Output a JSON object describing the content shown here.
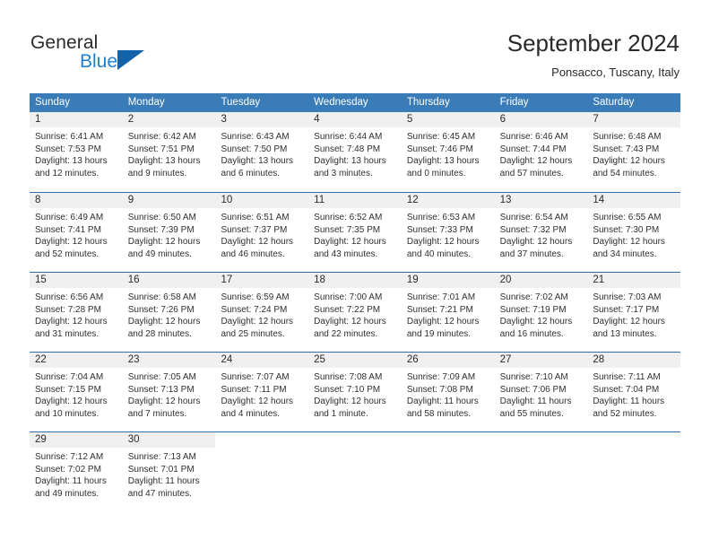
{
  "brand": {
    "name_part1": "General",
    "name_part2": "Blue",
    "triangle_color": "#1162a8",
    "blue_text_color": "#1f7fd0"
  },
  "header": {
    "month_title": "September 2024",
    "location": "Ponsacco, Tuscany, Italy"
  },
  "theme": {
    "header_row_bg": "#3a7cb8",
    "row_separator": "#2f6fae",
    "day_head_bg": "#f0f0f0",
    "page_bg": "#ffffff",
    "text": "#2a2a2a"
  },
  "weekdays": [
    "Sunday",
    "Monday",
    "Tuesday",
    "Wednesday",
    "Thursday",
    "Friday",
    "Saturday"
  ],
  "weeks": [
    [
      {
        "day": "1",
        "sunrise": "Sunrise: 6:41 AM",
        "sunset": "Sunset: 7:53 PM",
        "daylight_line1": "Daylight: 13 hours",
        "daylight_line2": "and 12 minutes."
      },
      {
        "day": "2",
        "sunrise": "Sunrise: 6:42 AM",
        "sunset": "Sunset: 7:51 PM",
        "daylight_line1": "Daylight: 13 hours",
        "daylight_line2": "and 9 minutes."
      },
      {
        "day": "3",
        "sunrise": "Sunrise: 6:43 AM",
        "sunset": "Sunset: 7:50 PM",
        "daylight_line1": "Daylight: 13 hours",
        "daylight_line2": "and 6 minutes."
      },
      {
        "day": "4",
        "sunrise": "Sunrise: 6:44 AM",
        "sunset": "Sunset: 7:48 PM",
        "daylight_line1": "Daylight: 13 hours",
        "daylight_line2": "and 3 minutes."
      },
      {
        "day": "5",
        "sunrise": "Sunrise: 6:45 AM",
        "sunset": "Sunset: 7:46 PM",
        "daylight_line1": "Daylight: 13 hours",
        "daylight_line2": "and 0 minutes."
      },
      {
        "day": "6",
        "sunrise": "Sunrise: 6:46 AM",
        "sunset": "Sunset: 7:44 PM",
        "daylight_line1": "Daylight: 12 hours",
        "daylight_line2": "and 57 minutes."
      },
      {
        "day": "7",
        "sunrise": "Sunrise: 6:48 AM",
        "sunset": "Sunset: 7:43 PM",
        "daylight_line1": "Daylight: 12 hours",
        "daylight_line2": "and 54 minutes."
      }
    ],
    [
      {
        "day": "8",
        "sunrise": "Sunrise: 6:49 AM",
        "sunset": "Sunset: 7:41 PM",
        "daylight_line1": "Daylight: 12 hours",
        "daylight_line2": "and 52 minutes."
      },
      {
        "day": "9",
        "sunrise": "Sunrise: 6:50 AM",
        "sunset": "Sunset: 7:39 PM",
        "daylight_line1": "Daylight: 12 hours",
        "daylight_line2": "and 49 minutes."
      },
      {
        "day": "10",
        "sunrise": "Sunrise: 6:51 AM",
        "sunset": "Sunset: 7:37 PM",
        "daylight_line1": "Daylight: 12 hours",
        "daylight_line2": "and 46 minutes."
      },
      {
        "day": "11",
        "sunrise": "Sunrise: 6:52 AM",
        "sunset": "Sunset: 7:35 PM",
        "daylight_line1": "Daylight: 12 hours",
        "daylight_line2": "and 43 minutes."
      },
      {
        "day": "12",
        "sunrise": "Sunrise: 6:53 AM",
        "sunset": "Sunset: 7:33 PM",
        "daylight_line1": "Daylight: 12 hours",
        "daylight_line2": "and 40 minutes."
      },
      {
        "day": "13",
        "sunrise": "Sunrise: 6:54 AM",
        "sunset": "Sunset: 7:32 PM",
        "daylight_line1": "Daylight: 12 hours",
        "daylight_line2": "and 37 minutes."
      },
      {
        "day": "14",
        "sunrise": "Sunrise: 6:55 AM",
        "sunset": "Sunset: 7:30 PM",
        "daylight_line1": "Daylight: 12 hours",
        "daylight_line2": "and 34 minutes."
      }
    ],
    [
      {
        "day": "15",
        "sunrise": "Sunrise: 6:56 AM",
        "sunset": "Sunset: 7:28 PM",
        "daylight_line1": "Daylight: 12 hours",
        "daylight_line2": "and 31 minutes."
      },
      {
        "day": "16",
        "sunrise": "Sunrise: 6:58 AM",
        "sunset": "Sunset: 7:26 PM",
        "daylight_line1": "Daylight: 12 hours",
        "daylight_line2": "and 28 minutes."
      },
      {
        "day": "17",
        "sunrise": "Sunrise: 6:59 AM",
        "sunset": "Sunset: 7:24 PM",
        "daylight_line1": "Daylight: 12 hours",
        "daylight_line2": "and 25 minutes."
      },
      {
        "day": "18",
        "sunrise": "Sunrise: 7:00 AM",
        "sunset": "Sunset: 7:22 PM",
        "daylight_line1": "Daylight: 12 hours",
        "daylight_line2": "and 22 minutes."
      },
      {
        "day": "19",
        "sunrise": "Sunrise: 7:01 AM",
        "sunset": "Sunset: 7:21 PM",
        "daylight_line1": "Daylight: 12 hours",
        "daylight_line2": "and 19 minutes."
      },
      {
        "day": "20",
        "sunrise": "Sunrise: 7:02 AM",
        "sunset": "Sunset: 7:19 PM",
        "daylight_line1": "Daylight: 12 hours",
        "daylight_line2": "and 16 minutes."
      },
      {
        "day": "21",
        "sunrise": "Sunrise: 7:03 AM",
        "sunset": "Sunset: 7:17 PM",
        "daylight_line1": "Daylight: 12 hours",
        "daylight_line2": "and 13 minutes."
      }
    ],
    [
      {
        "day": "22",
        "sunrise": "Sunrise: 7:04 AM",
        "sunset": "Sunset: 7:15 PM",
        "daylight_line1": "Daylight: 12 hours",
        "daylight_line2": "and 10 minutes."
      },
      {
        "day": "23",
        "sunrise": "Sunrise: 7:05 AM",
        "sunset": "Sunset: 7:13 PM",
        "daylight_line1": "Daylight: 12 hours",
        "daylight_line2": "and 7 minutes."
      },
      {
        "day": "24",
        "sunrise": "Sunrise: 7:07 AM",
        "sunset": "Sunset: 7:11 PM",
        "daylight_line1": "Daylight: 12 hours",
        "daylight_line2": "and 4 minutes."
      },
      {
        "day": "25",
        "sunrise": "Sunrise: 7:08 AM",
        "sunset": "Sunset: 7:10 PM",
        "daylight_line1": "Daylight: 12 hours",
        "daylight_line2": "and 1 minute."
      },
      {
        "day": "26",
        "sunrise": "Sunrise: 7:09 AM",
        "sunset": "Sunset: 7:08 PM",
        "daylight_line1": "Daylight: 11 hours",
        "daylight_line2": "and 58 minutes."
      },
      {
        "day": "27",
        "sunrise": "Sunrise: 7:10 AM",
        "sunset": "Sunset: 7:06 PM",
        "daylight_line1": "Daylight: 11 hours",
        "daylight_line2": "and 55 minutes."
      },
      {
        "day": "28",
        "sunrise": "Sunrise: 7:11 AM",
        "sunset": "Sunset: 7:04 PM",
        "daylight_line1": "Daylight: 11 hours",
        "daylight_line2": "and 52 minutes."
      }
    ],
    [
      {
        "day": "29",
        "sunrise": "Sunrise: 7:12 AM",
        "sunset": "Sunset: 7:02 PM",
        "daylight_line1": "Daylight: 11 hours",
        "daylight_line2": "and 49 minutes."
      },
      {
        "day": "30",
        "sunrise": "Sunrise: 7:13 AM",
        "sunset": "Sunset: 7:01 PM",
        "daylight_line1": "Daylight: 11 hours",
        "daylight_line2": "and 47 minutes."
      },
      {
        "day": "",
        "sunrise": "",
        "sunset": "",
        "daylight_line1": "",
        "daylight_line2": ""
      },
      {
        "day": "",
        "sunrise": "",
        "sunset": "",
        "daylight_line1": "",
        "daylight_line2": ""
      },
      {
        "day": "",
        "sunrise": "",
        "sunset": "",
        "daylight_line1": "",
        "daylight_line2": ""
      },
      {
        "day": "",
        "sunrise": "",
        "sunset": "",
        "daylight_line1": "",
        "daylight_line2": ""
      },
      {
        "day": "",
        "sunrise": "",
        "sunset": "",
        "daylight_line1": "",
        "daylight_line2": ""
      }
    ]
  ]
}
